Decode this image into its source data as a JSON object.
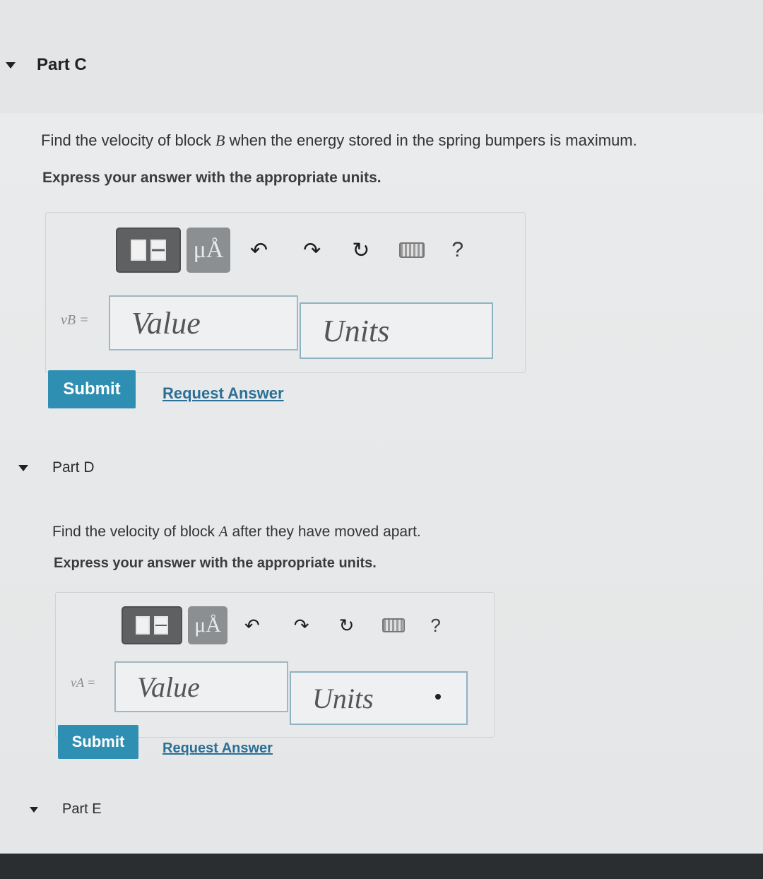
{
  "part_c": {
    "title": "Part C",
    "question_prefix": "Find the velocity of block ",
    "question_var": "B",
    "question_suffix": " when the energy stored in the spring bumpers is maximum.",
    "instruction": "Express your answer with the appropriate units.",
    "variable_label": "vB =",
    "value_placeholder": "Value",
    "units_placeholder": "Units",
    "submit_label": "Submit",
    "request_label": "Request Answer"
  },
  "part_d": {
    "title": "Part D",
    "question_prefix": "Find the velocity of block ",
    "question_var": "A",
    "question_suffix": " after they have moved apart.",
    "instruction": "Express your answer with the appropriate units.",
    "variable_label": "vA =",
    "value_placeholder": "Value",
    "units_placeholder": "Units",
    "submit_label": "Submit",
    "request_label": "Request Answer"
  },
  "part_e": {
    "title": "Part E"
  },
  "toolbar": {
    "templates_icon": "templates-icon",
    "units_symbol": "μÅ",
    "undo_glyph": "↶",
    "redo_glyph": "↷",
    "reset_glyph": "↻",
    "help_glyph": "?"
  },
  "colors": {
    "accent": "#2f8fb3",
    "link": "#2c6f95"
  }
}
